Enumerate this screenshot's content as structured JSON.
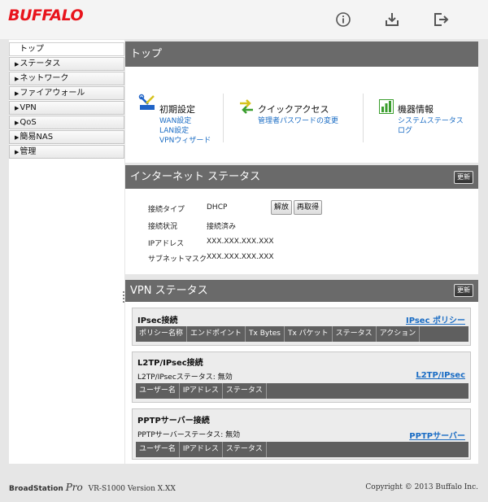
{
  "header": {
    "logo": "BUFFALO",
    "icons": [
      "info-icon",
      "download-icon",
      "logout-icon"
    ]
  },
  "sidebar": {
    "items": [
      {
        "label": "トップ",
        "arrow": ""
      },
      {
        "label": "ステータス",
        "arrow": "▶"
      },
      {
        "label": "ネットワーク",
        "arrow": "▶"
      },
      {
        "label": "ファイアウォール",
        "arrow": "▶"
      },
      {
        "label": "VPN",
        "arrow": "▶"
      },
      {
        "label": "QoS",
        "arrow": "▶"
      },
      {
        "label": "簡易NAS",
        "arrow": "▶"
      },
      {
        "label": "管理",
        "arrow": "▶"
      }
    ]
  },
  "top": {
    "title": "トップ",
    "initial": {
      "title": "初期設定",
      "links": [
        "WAN設定",
        "LAN設定",
        "VPNウィザード"
      ],
      "icon": "tools-icon"
    },
    "quick": {
      "title": "クイックアクセス",
      "links": [
        "管理者パスワードの変更"
      ],
      "icon": "swap-arrows-icon"
    },
    "device": {
      "title": "機器情報",
      "links": [
        "システムステータス",
        "ログ"
      ],
      "icon": "bar-chart-icon"
    }
  },
  "internet": {
    "title": "インターネット ステータス",
    "refresh": "更新",
    "rows": [
      {
        "label": "接続タイプ",
        "value": "DHCP"
      },
      {
        "label": "接続状況",
        "value": "接続済み"
      },
      {
        "label": "IPアドレス",
        "value": "XXX.XXX.XXX.XXX"
      },
      {
        "label": "サブネットマスク",
        "value": "XXX.XXX.XXX.XXX"
      }
    ],
    "release_btn": "解放",
    "renew_btn": "再取得"
  },
  "vpn": {
    "title": "VPN ステータス",
    "refresh": "更新",
    "ipsec": {
      "title": "IPsec接続",
      "link": "IPsec ポリシー",
      "columns": [
        "ポリシー名称",
        "エンドポイント",
        "Tx Bytes",
        "Tx パケット",
        "ステータス",
        "アクション"
      ]
    },
    "l2tp": {
      "title": "L2TP/IPsec接続",
      "link": "L2TP/IPsec",
      "status": "L2TP/IPsecステータス: 無効",
      "columns": [
        "ユーザー名",
        "IPアドレス",
        "ステータス"
      ]
    },
    "pptp": {
      "title": "PPTPサーバー接続",
      "link": "PPTPサーバー",
      "status": "PPTPサーバーステータス: 無効",
      "columns": [
        "ユーザー名",
        "IPアドレス",
        "ステータス"
      ]
    }
  },
  "footer": {
    "brand": "BroadStation",
    "pro": "Pro",
    "version": "VR-S1000 Version X.XX",
    "copyright": "Copyright © 2013 Buffalo Inc."
  },
  "colors": {
    "brand_red": "#e8141c",
    "link_blue": "#1a6cc4",
    "panel_header": "#6a6a6a",
    "icon_blue": "#1f63c7",
    "icon_green": "#3b9e2e",
    "icon_yellow": "#d6c21d"
  }
}
